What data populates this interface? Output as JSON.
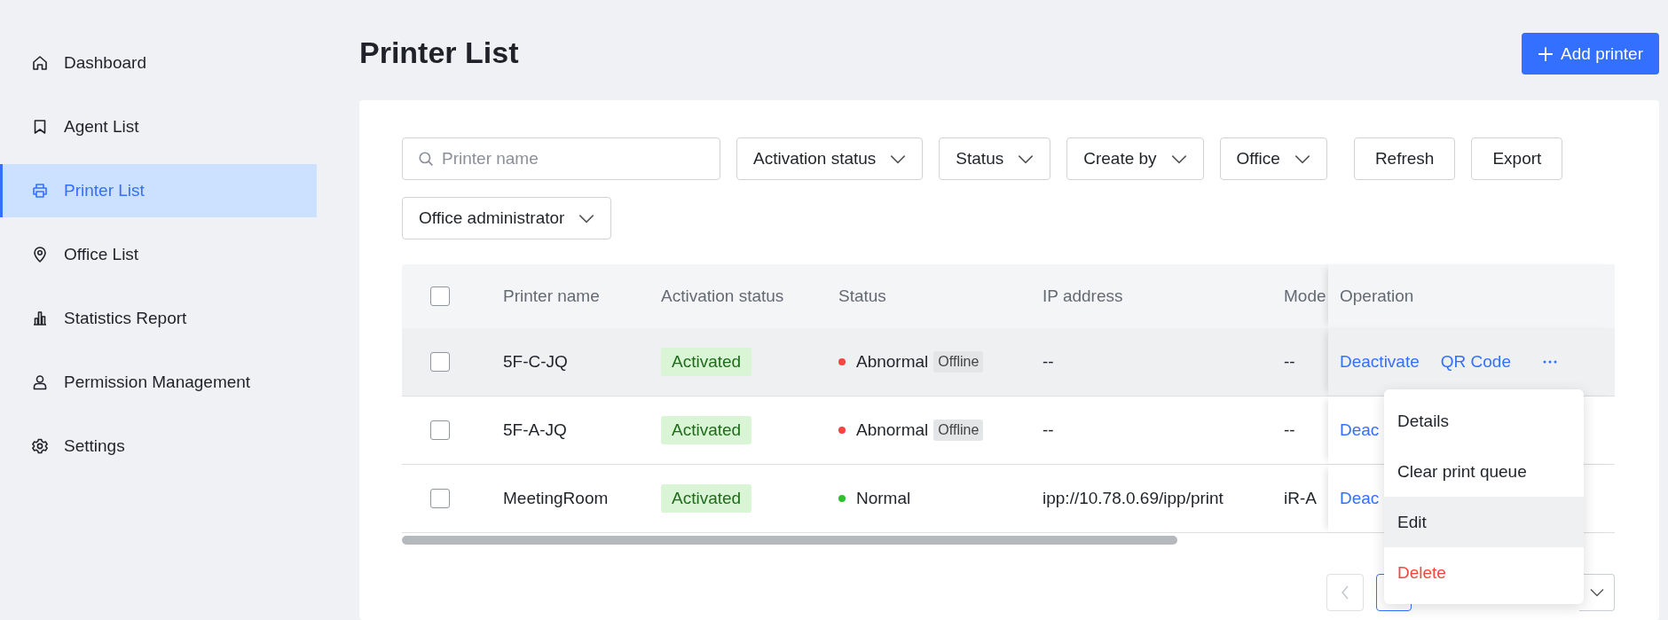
{
  "sidebar": {
    "items": [
      {
        "label": "Dashboard",
        "selected": false
      },
      {
        "label": "Agent List",
        "selected": false
      },
      {
        "label": "Printer List",
        "selected": true
      },
      {
        "label": "Office List",
        "selected": false
      },
      {
        "label": "Statistics Report",
        "selected": false
      },
      {
        "label": "Permission Management",
        "selected": false
      },
      {
        "label": "Settings",
        "selected": false
      }
    ]
  },
  "header": {
    "title": "Printer List",
    "add_button": "Add printer"
  },
  "filters": {
    "search": {
      "placeholder": "Printer name"
    },
    "items": [
      {
        "kind": "dropdown",
        "label": "Activation status"
      },
      {
        "kind": "dropdown",
        "label": "Status"
      },
      {
        "kind": "dropdown",
        "label": "Create by"
      },
      {
        "kind": "dropdown",
        "label": "Office"
      },
      {
        "kind": "button",
        "label": "Refresh"
      },
      {
        "kind": "button",
        "label": "Export"
      },
      {
        "kind": "dropdown",
        "label": "Office administrator"
      }
    ]
  },
  "table": {
    "select_all": {
      "checked": false
    },
    "columns": [
      "Printer name",
      "Activation status",
      "Status",
      "IP address",
      "Mode",
      "Operation"
    ],
    "rows": [
      {
        "checked": false,
        "highlighted": true,
        "name": "5F-C-JQ",
        "activation": "Activated",
        "status": {
          "text": "Abnormal",
          "color": "#f5453d",
          "tag": "Offline"
        },
        "ip": "--",
        "model": "--",
        "operations": [
          "Deactivate",
          "QR Code"
        ]
      },
      {
        "checked": false,
        "highlighted": false,
        "name": "5F-A-JQ",
        "activation": "Activated",
        "status": {
          "text": "Abnormal",
          "color": "#f5453d",
          "tag": "Offline"
        },
        "ip": "--",
        "model": "--",
        "operations": [
          "Deac"
        ]
      },
      {
        "checked": false,
        "highlighted": false,
        "name": "MeetingRoom",
        "activation": "Activated",
        "status": {
          "text": "Normal",
          "color": "#2fc02f"
        },
        "ip": "ipp://10.78.0.69/ipp/print",
        "model": "iR-A",
        "operations": [
          "Deac"
        ]
      }
    ]
  },
  "menu": {
    "items": [
      {
        "label": "Details",
        "kind": "normal",
        "highlighted": false
      },
      {
        "label": "Clear print queue",
        "kind": "normal",
        "highlighted": false
      },
      {
        "label": "Edit",
        "kind": "normal",
        "highlighted": true
      },
      {
        "label": "Delete",
        "kind": "danger",
        "highlighted": false
      }
    ]
  }
}
